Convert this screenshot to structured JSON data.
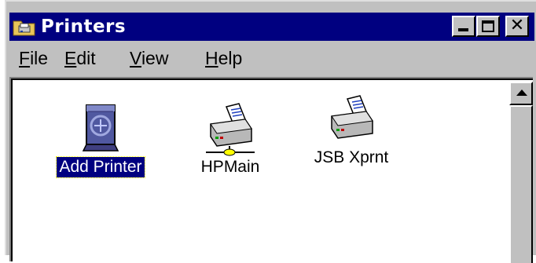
{
  "window": {
    "title": "Printers",
    "title_icon": "printers-folder-icon",
    "buttons": {
      "minimize": "_",
      "maximize": "□",
      "close": "×"
    }
  },
  "menu": {
    "items": [
      {
        "label": "File"
      },
      {
        "label": "Edit"
      },
      {
        "label": "View"
      },
      {
        "label": "Help"
      }
    ]
  },
  "content": {
    "items": [
      {
        "label": "Add Printer",
        "icon": "add-printer-icon",
        "selected": true
      },
      {
        "label": "HPMain",
        "icon": "network-printer-icon",
        "selected": false
      },
      {
        "label": "JSB Xprnt",
        "icon": "printer-icon",
        "selected": false
      }
    ]
  },
  "colors": {
    "titlebar": "#000080",
    "face": "#c0c0c0",
    "selection": "#000080"
  }
}
